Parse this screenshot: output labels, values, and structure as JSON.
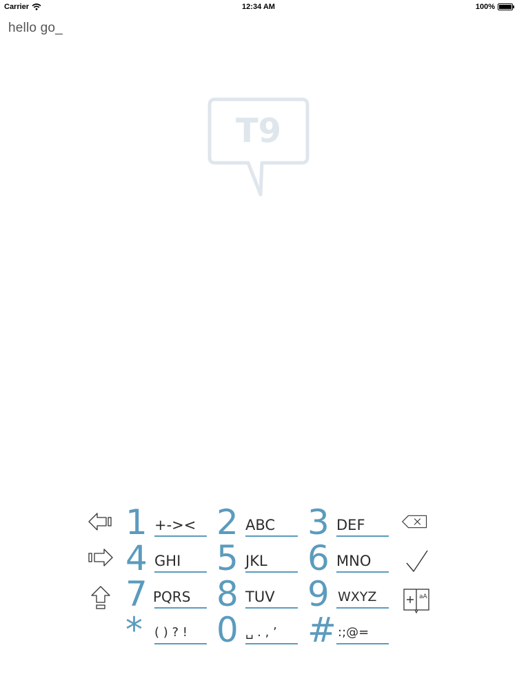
{
  "status_bar": {
    "carrier": "Carrier",
    "time": "12:34 AM",
    "battery": "100%"
  },
  "text_field": {
    "value": "hello go_"
  },
  "logo": {
    "text": "T9",
    "color": "#dfe6ec"
  },
  "keypad": {
    "accent_color": "#5b9bbd",
    "keys": [
      {
        "digit": "1",
        "letters": "+-><"
      },
      {
        "digit": "2",
        "letters": "ABC"
      },
      {
        "digit": "3",
        "letters": "DEF"
      },
      {
        "digit": "4",
        "letters": "GHI"
      },
      {
        "digit": "5",
        "letters": "JKL"
      },
      {
        "digit": "6",
        "letters": "MNO"
      },
      {
        "digit": "7",
        "letters": "PQRS"
      },
      {
        "digit": "8",
        "letters": "TUV"
      },
      {
        "digit": "9",
        "letters": "WXYZ"
      },
      {
        "digit": "*",
        "letters": "( ) ? !"
      },
      {
        "digit": "0",
        "letters": "␣ . , ’"
      },
      {
        "digit": "#",
        "letters": ":;@="
      }
    ],
    "side_buttons": {
      "left": [
        "arrow-left-icon",
        "arrow-right-icon",
        "shift-up-icon"
      ],
      "right": [
        "backspace-icon",
        "checkmark-icon",
        "add-word-icon"
      ]
    }
  }
}
